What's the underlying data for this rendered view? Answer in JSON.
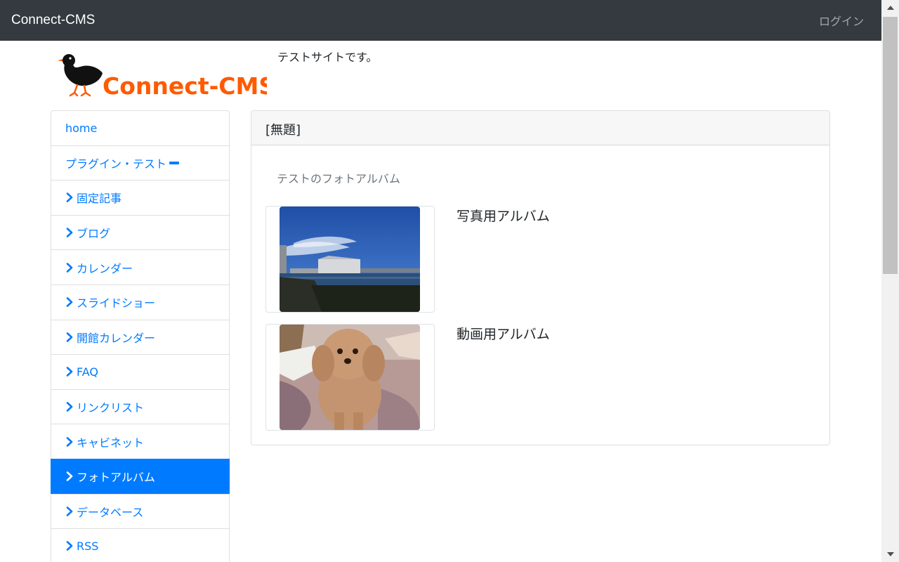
{
  "topbar": {
    "brand": "Connect-CMS",
    "login": "ログイン"
  },
  "header": {
    "logo_text": "Connect-CMS",
    "site_description": "テストサイトです。"
  },
  "menu": {
    "items": [
      {
        "label": "home"
      },
      {
        "label": "プラグイン・テスト"
      },
      {
        "label": "固定記事"
      },
      {
        "label": "ブログ"
      },
      {
        "label": "カレンダー"
      },
      {
        "label": "スライドショー"
      },
      {
        "label": "開館カレンダー"
      },
      {
        "label": "FAQ"
      },
      {
        "label": "リンクリスト"
      },
      {
        "label": "キャビネット"
      },
      {
        "label": "フォトアルバム"
      },
      {
        "label": "データベース"
      },
      {
        "label": "RSS"
      }
    ],
    "active": "フォトアルバム"
  },
  "main": {
    "card_title": "[無題]",
    "album_description": "テストのフォトアルバム",
    "albums": [
      {
        "title": "写真用アルバム",
        "thumbnail": "building-by-water-photo"
      },
      {
        "title": "動画用アルバム",
        "thumbnail": "poodle-dog-photo"
      }
    ]
  },
  "colors": {
    "topbar": "#343a40",
    "link": "#007bff",
    "active_bg": "#007bff",
    "logo_orange": "#ff5a00"
  }
}
